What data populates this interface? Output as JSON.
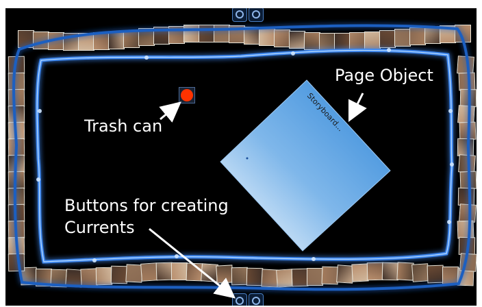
{
  "annotations": {
    "page_object": "Page Object",
    "trash_can": "Trash can",
    "buttons_line1": "Buttons for creating",
    "buttons_line2": "Currents"
  },
  "page_object": {
    "label": "Storyboard..."
  },
  "colors": {
    "background": "#000000",
    "frame_glow": "#2d6fd1",
    "page_gradient_start": "#2f86d8",
    "page_gradient_end": "#ffffff",
    "trash": "#ff3300",
    "annotation_text": "#ffffff"
  },
  "icons": {
    "trash": "trash-can-icon",
    "current_button": "create-current-icon"
  }
}
